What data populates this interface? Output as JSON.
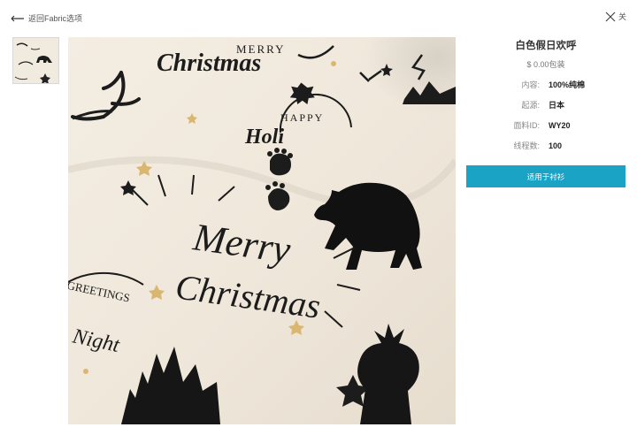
{
  "nav": {
    "back_label": "返回Fabric选项",
    "close_label": "关"
  },
  "product": {
    "title": "白色假日欢呼",
    "price": "$ 0.00包装",
    "specs": [
      {
        "label": "内容:",
        "value": "100%纯棉"
      },
      {
        "label": "起源:",
        "value": "日本"
      },
      {
        "label": "面料ID:",
        "value": "WY20"
      },
      {
        "label": "线程数:",
        "value": "100"
      }
    ],
    "apply_label": "适用于衬衫"
  },
  "fabric_print": {
    "texts": [
      "MERRY",
      "Christmas",
      "HAPPY",
      "Holi",
      "Merry",
      "Christmas",
      "GREETINGS",
      "Night"
    ]
  },
  "colors": {
    "accent": "#1aa3c4",
    "fabric": "#f3ece1",
    "ink": "#1c1c1c",
    "gold": "#d9b770"
  },
  "icons": {
    "back": "arrow-left-icon",
    "close": "close-x-icon"
  }
}
